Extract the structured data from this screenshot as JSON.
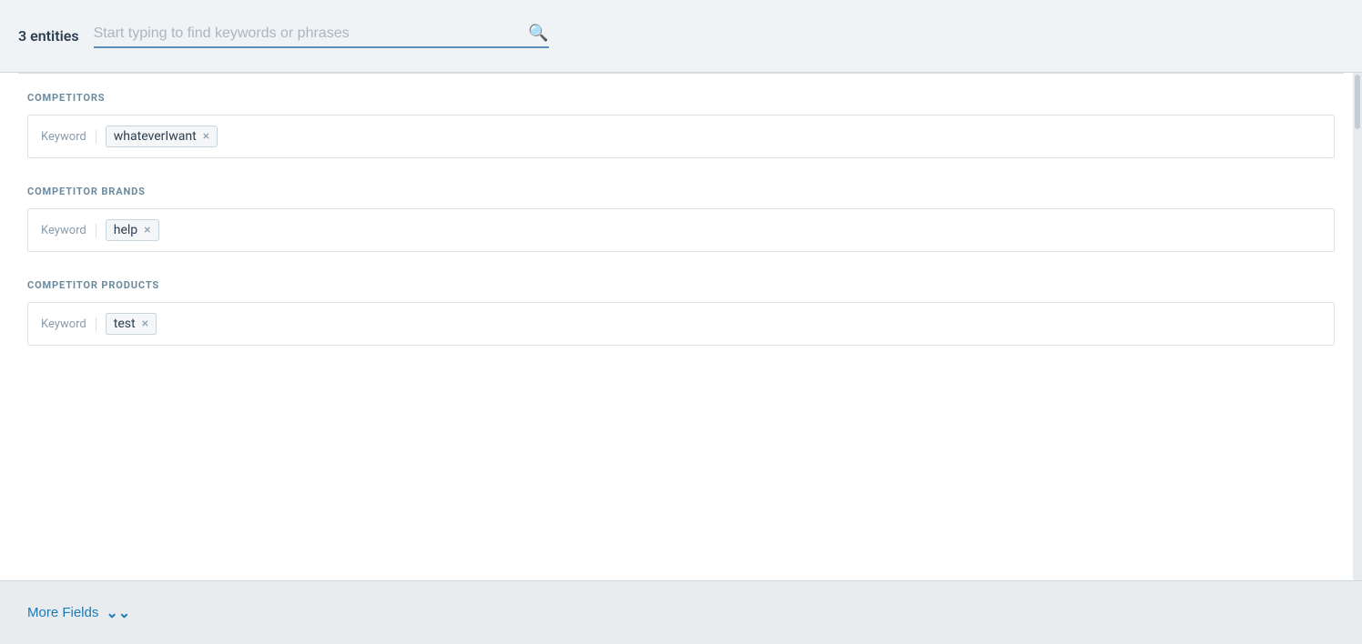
{
  "header": {
    "entities_count": "3 entities",
    "search_placeholder": "Start typing to find keywords or phrases"
  },
  "sections": [
    {
      "id": "competitors",
      "title": "COMPETITORS",
      "keyword_label": "Keyword",
      "tags": [
        {
          "text": "whateverIwant"
        }
      ]
    },
    {
      "id": "competitor-brands",
      "title": "COMPETITOR BRANDS",
      "keyword_label": "Keyword",
      "tags": [
        {
          "text": "help"
        }
      ]
    },
    {
      "id": "competitor-products",
      "title": "COMPETITOR PRODUCTS",
      "keyword_label": "Keyword",
      "tags": [
        {
          "text": "test"
        }
      ]
    }
  ],
  "footer": {
    "more_fields_label": "More Fields",
    "more_fields_icon": "⌄⌄"
  },
  "icons": {
    "search": "🔍",
    "close": "×",
    "chevron_down": "⌄"
  }
}
